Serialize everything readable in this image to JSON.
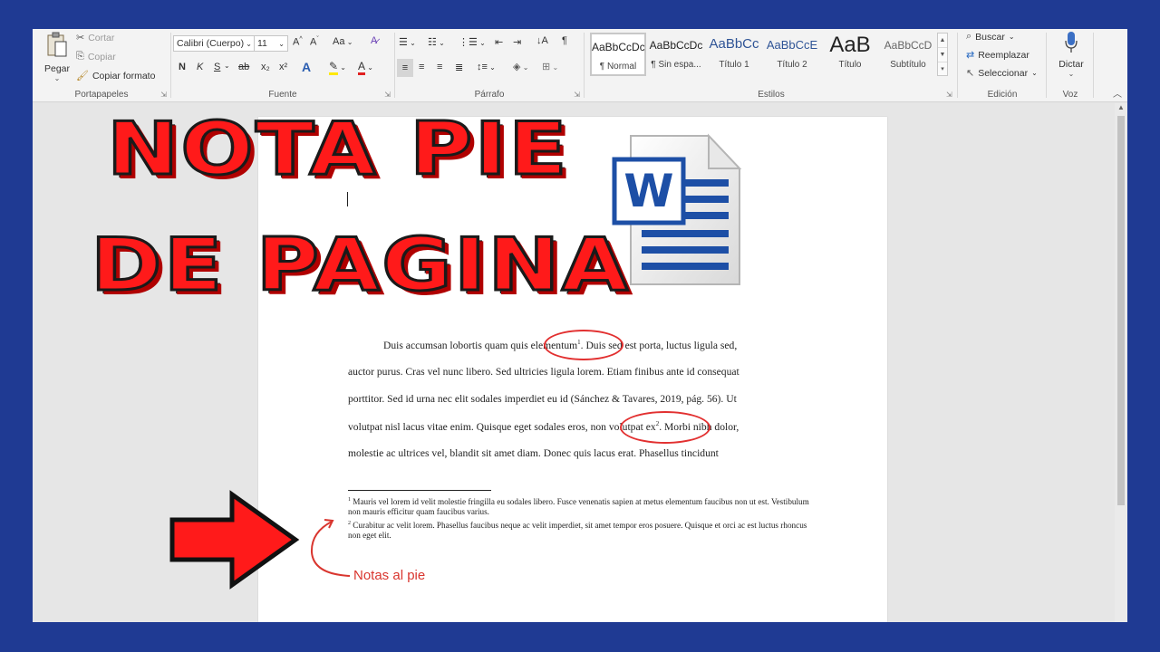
{
  "clipboard": {
    "paste": "Pegar",
    "cut": "Cortar",
    "copy": "Copiar",
    "format_painter": "Copiar formato",
    "label": "Portapapeles"
  },
  "font": {
    "family": "Calibri (Cuerpo)",
    "size": "11",
    "grow": "A^",
    "shrink": "A˅",
    "case": "Aa",
    "bold": "N",
    "italic": "K",
    "underline": "S",
    "strike": "ab",
    "subscript": "x₂",
    "superscript": "x²",
    "label": "Fuente"
  },
  "paragraph": {
    "label": "Párrafo",
    "pilcrow": "¶"
  },
  "styles": {
    "label": "Estilos",
    "items": [
      {
        "preview": "AaBbCcDc",
        "name": "¶ Normal"
      },
      {
        "preview": "AaBbCcDc",
        "name": "¶ Sin espa..."
      },
      {
        "preview": "AaBbCc",
        "name": "Título 1"
      },
      {
        "preview": "AaBbCcE",
        "name": "Título 2"
      },
      {
        "preview": "AaB",
        "name": "Título"
      },
      {
        "preview": "AaBbCcD",
        "name": "Subtítulo"
      }
    ]
  },
  "editing": {
    "find": "Buscar",
    "replace": "Reemplazar",
    "select": "Seleccionar",
    "label": "Edición"
  },
  "voice": {
    "dictate": "Dictar",
    "label": "Voz"
  },
  "thumbnail": {
    "line1": "NOTA PIE",
    "line2": "DE PAGINA",
    "word_letter": "W",
    "notes_label": "Notas al pie",
    "accent_color": "#ff1a1a"
  },
  "document": {
    "p1a": "Duis accumsan lobortis quam quis ",
    "p1_ref": "elementum",
    "p1_sup": "1",
    "p1b": ". Duis sed est porta, luctus ligula sed,",
    "p2": "auctor purus. Cras vel nunc libero. Sed ultricies ligula lorem. Etiam finibus ante id consequat",
    "p3": "porttitor. Sed id urna nec elit sodales imperdiet eu id (Sánchez & Tavares, 2019, pág. 56). Ut",
    "p4a": "volutpat nisl lacus vitae enim. Quisque eget sodales eros, ",
    "p4_ref": "non volutpat ex",
    "p4_sup": "2",
    "p4b": ". Morbi nibh dolor,",
    "p5": "molestie ac ultrices vel, blandit sit amet diam. Donec quis lacus erat. Phasellus tincidunt",
    "fn1_num": "1",
    "fn1": " Mauris vel lorem id velit molestie fringilla eu sodales libero. Fusce venenatis sapien at metus elementum faucibus non ut est. Vestibulum non mauris efficitur quam faucibus varius.",
    "fn2_num": "2",
    "fn2": " Curabitur ac velit lorem. Phasellus faucibus neque ac velit imperdiet, sit amet tempor eros posuere. Quisque et orci ac est luctus rhoncus non eget elit."
  }
}
